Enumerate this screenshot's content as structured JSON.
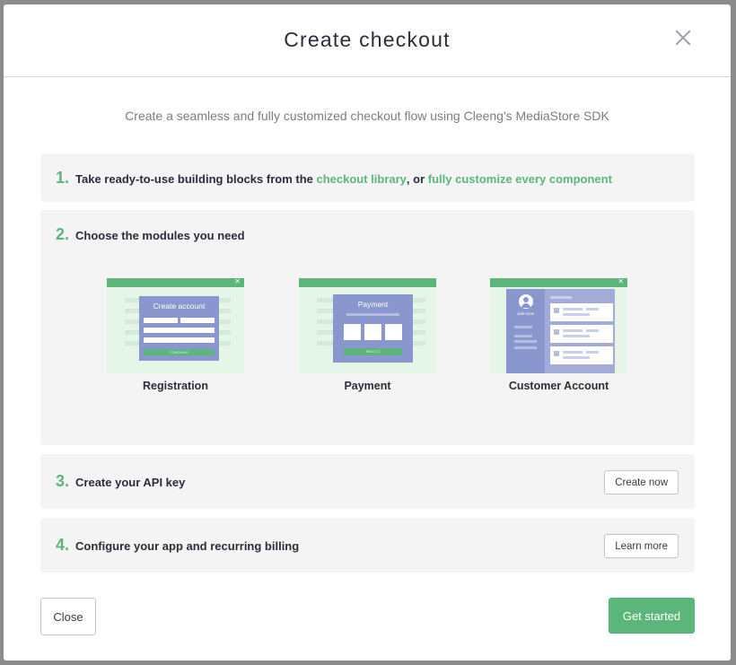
{
  "modal": {
    "title": "Create checkout",
    "subtitle": "Create a seamless and fully customized checkout flow using Cleeng's MediaStore SDK"
  },
  "steps": [
    {
      "number": "1.",
      "text_before": "Take ready-to-use building blocks from the ",
      "link1": "checkout library",
      "text_middle": ", or ",
      "link2": "fully customize every component"
    },
    {
      "number": "2.",
      "text": "Choose the modules you need",
      "modules": [
        {
          "label": "Registration",
          "card_title": "Create account",
          "button_text": "CONTINUE"
        },
        {
          "label": "Payment",
          "card_title": "Payment",
          "button_text": "SELECT"
        },
        {
          "label": "Customer Account",
          "user_name": "John Doe"
        }
      ]
    },
    {
      "number": "3.",
      "text": "Create your API key",
      "button": "Create now"
    },
    {
      "number": "4.",
      "text": "Configure your app and recurring billing",
      "button": "Learn more"
    }
  ],
  "footer": {
    "close": "Close",
    "get_started": "Get started"
  },
  "icons": {
    "close": "close-icon",
    "avatar": "user-avatar-icon"
  },
  "colors": {
    "accent": "#5cb67b",
    "card": "#8a96ce",
    "panel": "#f4f4f4"
  }
}
